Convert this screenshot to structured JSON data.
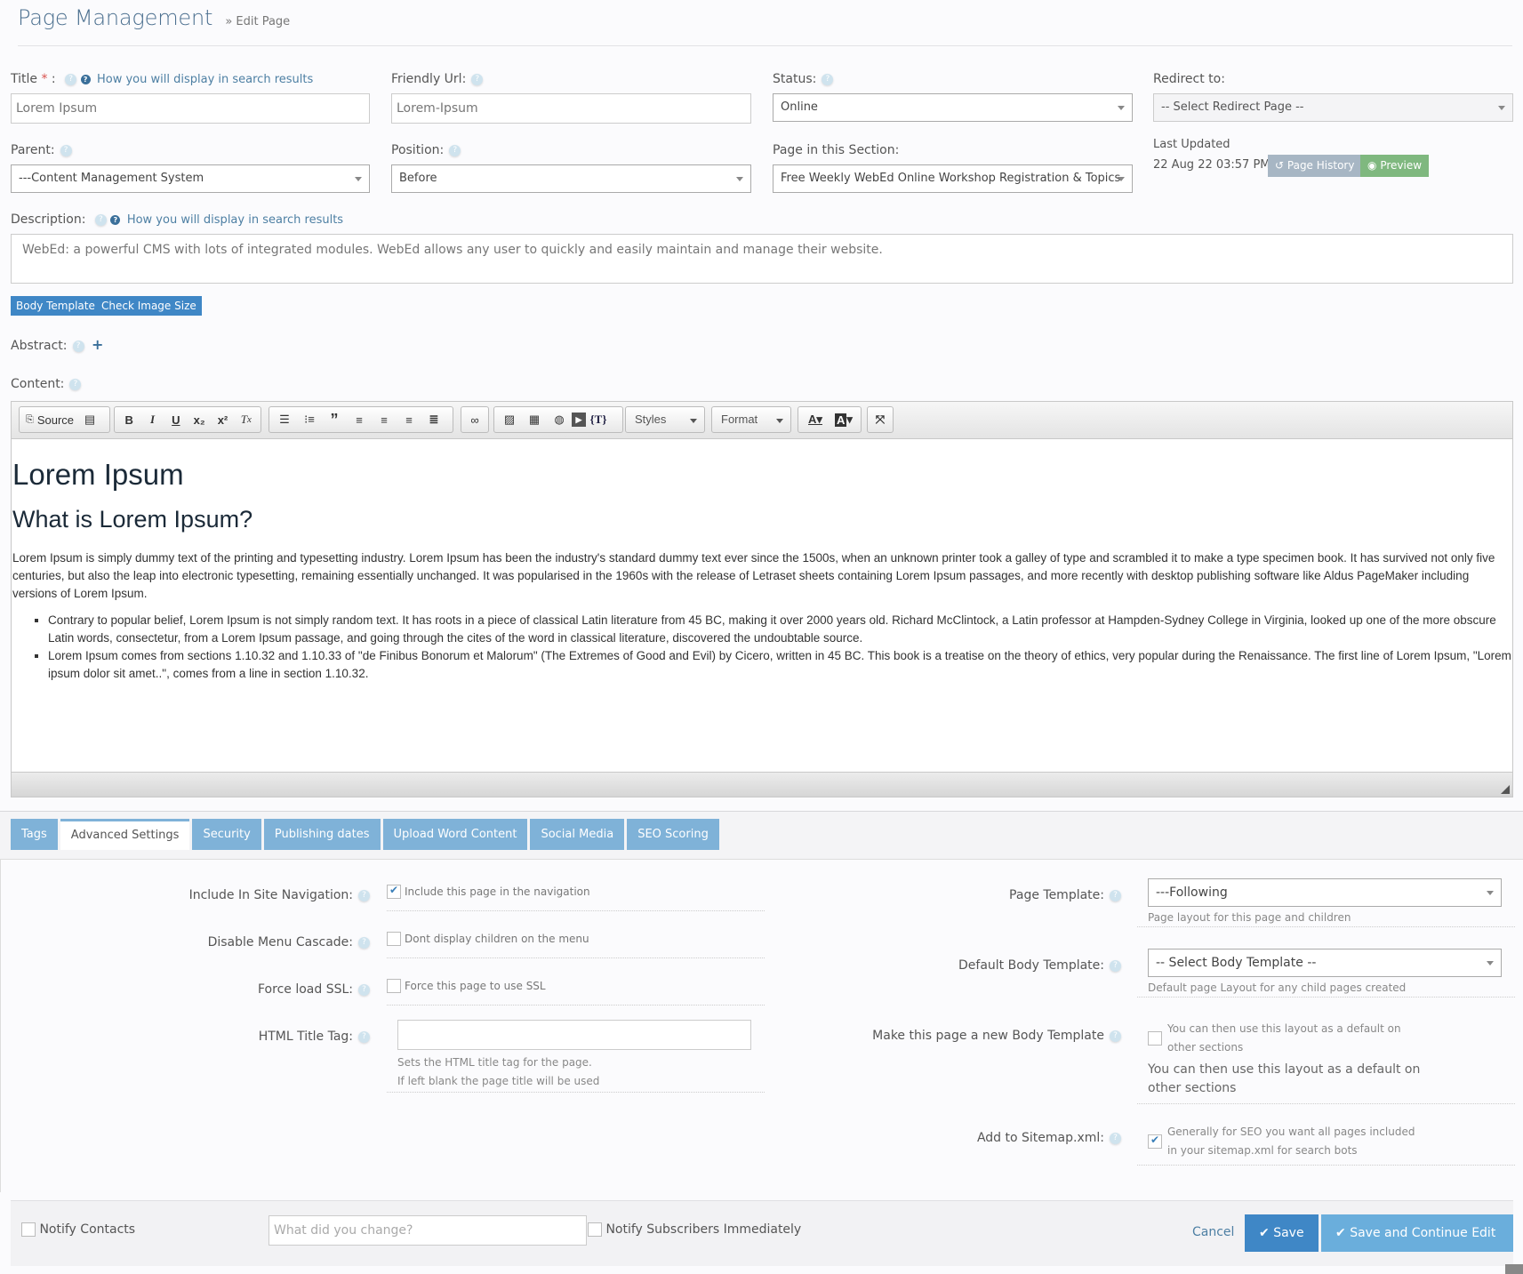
{
  "header": {
    "title": "Page Management",
    "crumb": "» Edit Page"
  },
  "help_link": "How you will display in search results",
  "form": {
    "title": {
      "label": "Title",
      "required": "*",
      "colon": ":",
      "value": "Lorem Ipsum"
    },
    "friendly_url": {
      "label": "Friendly Url:",
      "value": "Lorem-Ipsum"
    },
    "status": {
      "label": "Status:",
      "value": "Online"
    },
    "redirect": {
      "label": "Redirect to:",
      "value": "-- Select Redirect Page --"
    },
    "parent": {
      "label": "Parent:",
      "value": "---Content Management System"
    },
    "position": {
      "label": "Position:",
      "value": "Before"
    },
    "section": {
      "label": "Page in this Section:",
      "value": "Free Weekly WebEd Online Workshop Registration & Topics"
    },
    "last_updated": {
      "label": "Last Updated",
      "value": "22 Aug 22 03:57 PM"
    },
    "page_history": "Page History",
    "preview": "Preview",
    "description": {
      "label": "Description:",
      "value": "WebEd: a powerful CMS with lots of integrated modules. WebEd allows any user to quickly and easily maintain and manage their website."
    },
    "body_template": "Body Template",
    "check_image_size": "Check Image Size",
    "abstract": {
      "label": "Abstract:"
    },
    "content": {
      "label": "Content:"
    }
  },
  "editor": {
    "source": "Source",
    "styles": "Styles",
    "format": "Format",
    "h1": "Lorem Ipsum",
    "h2": "What is Lorem Ipsum?",
    "paragraph": "Lorem Ipsum is simply dummy text of the printing and typesetting industry. Lorem Ipsum has been the industry's standard dummy text ever since the 1500s, when an unknown printer took a galley of type and scrambled it to make a type specimen book. It has survived not only five centuries, but also the leap into electronic typesetting, remaining essentially unchanged. It was popularised in the 1960s with the release of Letraset sheets containing Lorem Ipsum passages, and more recently with desktop publishing software like Aldus PageMaker including versions of Lorem Ipsum.",
    "bullets": [
      "Contrary to popular belief, Lorem Ipsum is not simply random text. It has roots in a piece of classical Latin literature from 45 BC, making it over 2000 years old. Richard McClintock, a Latin professor at Hampden-Sydney College in Virginia, looked up one of the more obscure Latin words, consectetur, from a Lorem Ipsum passage, and going through the cites of the word in classical literature, discovered the undoubtable source.",
      "Lorem Ipsum comes from sections 1.10.32 and 1.10.33 of \"de Finibus Bonorum et Malorum\" (The Extremes of Good and Evil) by Cicero, written in 45 BC. This book is a treatise on the theory of ethics, very popular during the Renaissance. The first line of Lorem Ipsum, \"Lorem ipsum dolor sit amet..\", comes from a line in section 1.10.32."
    ]
  },
  "tabs": [
    {
      "label": "Tags"
    },
    {
      "label": "Advanced Settings",
      "active": true
    },
    {
      "label": "Security"
    },
    {
      "label": "Publishing dates"
    },
    {
      "label": "Upload Word Content"
    },
    {
      "label": "Social Media"
    },
    {
      "label": "SEO Scoring"
    }
  ],
  "advanced": {
    "nav": {
      "label": "Include In Site Navigation:",
      "checkbox": "Include this page in the navigation",
      "checked": true
    },
    "cascade": {
      "label": "Disable Menu Cascade:",
      "checkbox": "Dont display children on the menu",
      "checked": false
    },
    "ssl": {
      "label": "Force load SSL:",
      "checkbox": "Force this page to use SSL",
      "checked": false
    },
    "title_tag": {
      "label": "HTML Title Tag:",
      "value": "",
      "hint1": "Sets the HTML title tag for the page.",
      "hint2": "If left blank the page title will be used"
    },
    "page_template": {
      "label": "Page Template:",
      "value": "---Following",
      "hint": "Page layout for this page and children"
    },
    "body_template": {
      "label": "Default Body Template:",
      "value": "-- Select Body Template --",
      "hint": "Default page Layout for any child pages created"
    },
    "new_body": {
      "label": "Make this page a new Body Template",
      "checkbox1": "You can then use this layout as a default on",
      "checkbox2": "other sections",
      "text1": "You can then use this layout as a default on",
      "text2": "other sections",
      "checked": false
    },
    "sitemap": {
      "label": "Add to Sitemap.xml:",
      "checkbox1": "Generally for SEO you want all pages included",
      "checkbox2": "in your sitemap.xml for search bots",
      "checked": true
    }
  },
  "footer": {
    "notify_contacts": "Notify Contacts",
    "change_placeholder": "What did you change?",
    "notify_subscribers": "Notify Subscribers Immediately",
    "cancel": "Cancel",
    "save": "Save",
    "save_continue": "Save and Continue Edit"
  },
  "colors": {
    "accent": "#3f87c6",
    "tab": "#7fb2d8",
    "preview": "#7fb87f",
    "history": "#a7b6c4"
  }
}
